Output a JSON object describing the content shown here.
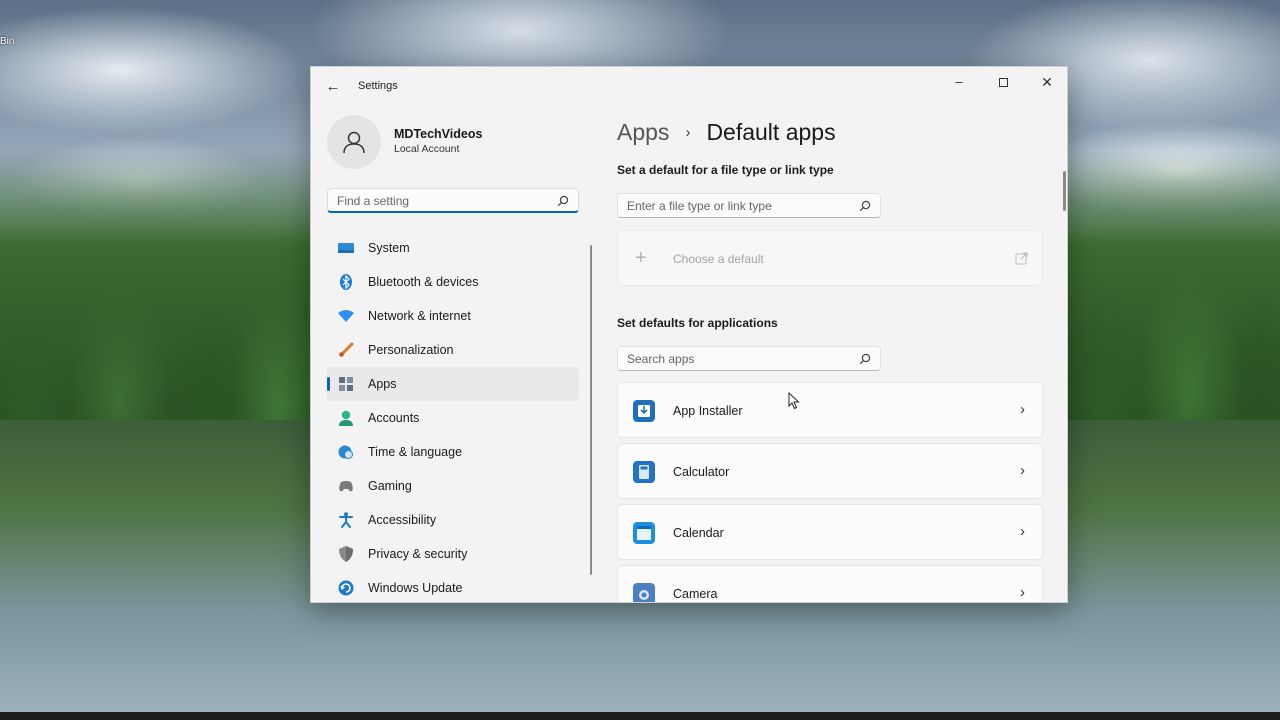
{
  "desktop": {
    "recycle_bin_label": "Bin"
  },
  "window": {
    "title": "Settings",
    "controls": {
      "minimize": "minimize",
      "maximize": "maximize",
      "close": "close"
    }
  },
  "profile": {
    "name": "MDTechVideos",
    "account_type": "Local Account"
  },
  "sidebar": {
    "search_placeholder": "Find a setting",
    "items": [
      {
        "label": "System",
        "icon": "system-icon",
        "color": "#2a8bd8"
      },
      {
        "label": "Bluetooth & devices",
        "icon": "bluetooth-icon",
        "color": "#1e7ed6"
      },
      {
        "label": "Network & internet",
        "icon": "wifi-icon",
        "color": "#2f8ff0"
      },
      {
        "label": "Personalization",
        "icon": "brush-icon",
        "color": "#e0792b"
      },
      {
        "label": "Apps",
        "icon": "apps-icon",
        "color": "#5b6f86",
        "active": true
      },
      {
        "label": "Accounts",
        "icon": "accounts-icon",
        "color": "#2bb58a"
      },
      {
        "label": "Time & language",
        "icon": "globe-clock-icon",
        "color": "#2a88d0"
      },
      {
        "label": "Gaming",
        "icon": "gamepad-icon",
        "color": "#7a7a7a"
      },
      {
        "label": "Accessibility",
        "icon": "accessibility-icon",
        "color": "#1a7ac8"
      },
      {
        "label": "Privacy & security",
        "icon": "shield-icon",
        "color": "#8a8a8a"
      },
      {
        "label": "Windows Update",
        "icon": "update-icon",
        "color": "#1a7ac8"
      }
    ]
  },
  "main": {
    "breadcrumb": {
      "parent": "Apps",
      "separator": "›",
      "current": "Default apps"
    },
    "filetype_section": {
      "title": "Set a default for a file type or link type",
      "search_placeholder": "Enter a file type or link type",
      "choose_label": "Choose a default"
    },
    "apps_section": {
      "title": "Set defaults for applications",
      "search_placeholder": "Search apps",
      "apps": [
        {
          "name": "App Installer",
          "icon": "app-installer-icon",
          "color": "#1f6fbf"
        },
        {
          "name": "Calculator",
          "icon": "calculator-icon",
          "color": "#2472c8"
        },
        {
          "name": "Calendar",
          "icon": "calendar-icon",
          "color": "#1e8ee0"
        },
        {
          "name": "Camera",
          "icon": "camera-icon",
          "color": "#4a7fc0"
        }
      ]
    }
  }
}
